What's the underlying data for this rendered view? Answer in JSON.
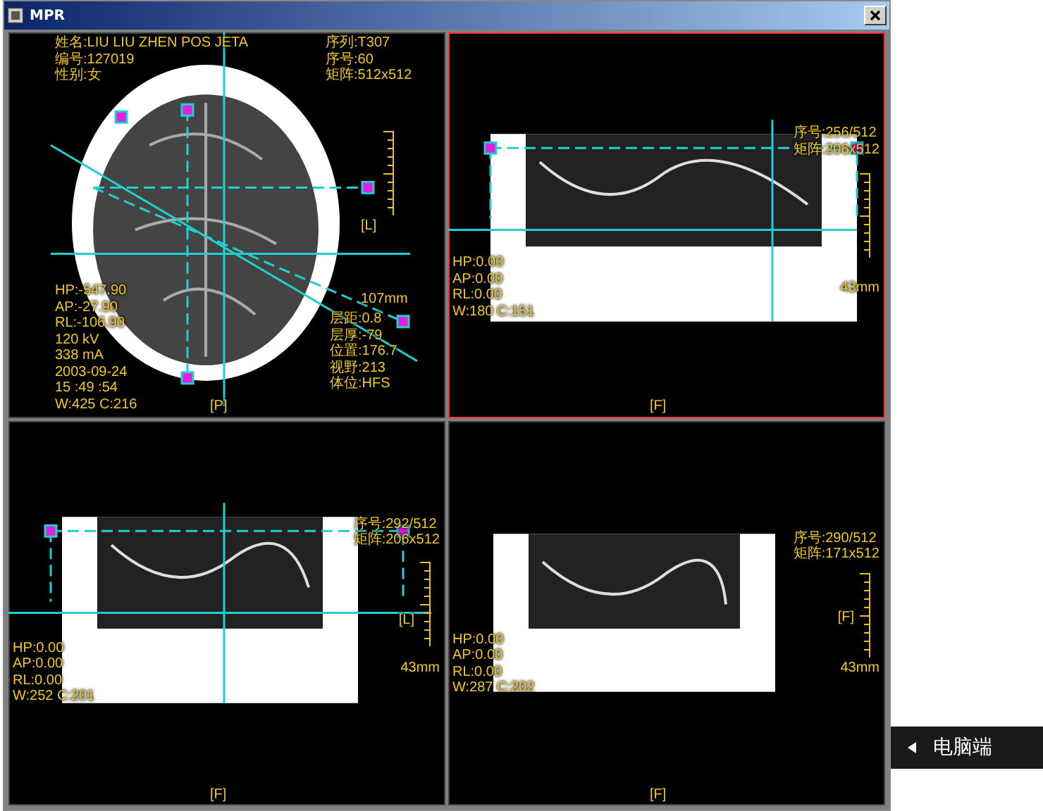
{
  "window": {
    "title": "MPR"
  },
  "viewports": [
    {
      "kind": "axial",
      "selected": false,
      "top_left": [
        "姓名:LIU LIU ZHEN POS JETA",
        "编号:127019",
        "性别:女"
      ],
      "top_right": [
        "序列:T307",
        "序号:60",
        "矩阵:512x512"
      ],
      "bottom_left": [
        "HP:-547.90",
        "AP:-27.90",
        "RL:-106.90",
        "120 kV",
        "338 mA",
        "2003-09-24",
        "15 :49 :54",
        "W:425 C:216"
      ],
      "bottom_right": [
        "层距:0.8",
        "层厚:-79",
        "位置:176.7",
        "视野:213",
        "体位:HFS"
      ],
      "bottom_center": "[P]",
      "side_marker": "[L]",
      "scale_label": "107mm"
    },
    {
      "kind": "sagittal",
      "selected": true,
      "top_right": [
        "序号:256/512",
        "矩阵:206x512"
      ],
      "bottom_left": [
        "HP:0.00",
        "AP:0.00",
        "RL:0.00",
        "W:180 C:151"
      ],
      "bottom_center": "[F]",
      "scale_label": "43mm"
    },
    {
      "kind": "coronal",
      "selected": false,
      "top_right": [
        "序号:292/512",
        "矩阵:206x512"
      ],
      "bottom_left": [
        "HP:0.00",
        "AP:0.00",
        "RL:0.00",
        "W:252 C:201"
      ],
      "bottom_center": "[F]",
      "side_marker": "[L]",
      "scale_label": "43mm"
    },
    {
      "kind": "oblique",
      "selected": false,
      "top_right": [
        "序号:290/512",
        "矩阵:171x512"
      ],
      "bottom_left": [
        "HP:0.00",
        "AP:0.00",
        "RL:0.00",
        "W:287 C:202"
      ],
      "bottom_center": "[F]",
      "side_marker": "[F]",
      "scale_label": "43mm"
    }
  ],
  "side_button": {
    "label": "电脑端"
  }
}
